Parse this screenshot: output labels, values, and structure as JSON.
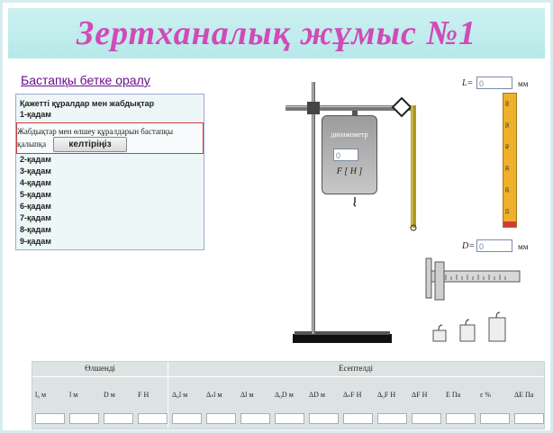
{
  "title": "Зертханалық жұмыс №1",
  "back_link": "Бастапқы бетке оралу",
  "steps": {
    "heading": "Қажетті құралдар мен жабдықтар",
    "step1": "1-қадам",
    "instruction": "Жабдықтар мен өлшеу құралдарын бастапқы қалыпқа",
    "button": "келтіріңіз",
    "items": [
      "2-қадам",
      "3-қадам",
      "4-қадам",
      "5-қадам",
      "6-қадам",
      "7-қадам",
      "8-қадам",
      "9-қадам"
    ]
  },
  "dynamometer": {
    "label": "динамометр",
    "value": "0",
    "unit_label": "F [ H ]"
  },
  "length": {
    "label": "L=",
    "value": "0",
    "unit": "мм"
  },
  "diameter": {
    "label": "D=",
    "value": "0",
    "unit": "мм"
  },
  "ruler": {
    "ticks": [
      "60",
      "50",
      "40",
      "30",
      "20",
      "10"
    ]
  },
  "table": {
    "measured_label": "Өлшенді",
    "computed_label": "Есептелді",
    "columns": [
      "l₀ м",
      "l м",
      "D м",
      "F Н",
      "Δ₀l м",
      "Δₛl м",
      "Δl м",
      "Δ₀D м",
      "ΔD м",
      "ΔₛF Н",
      "Δ₀F Н",
      "ΔF Н",
      "E Па",
      "ε %",
      "ΔE Па"
    ]
  }
}
